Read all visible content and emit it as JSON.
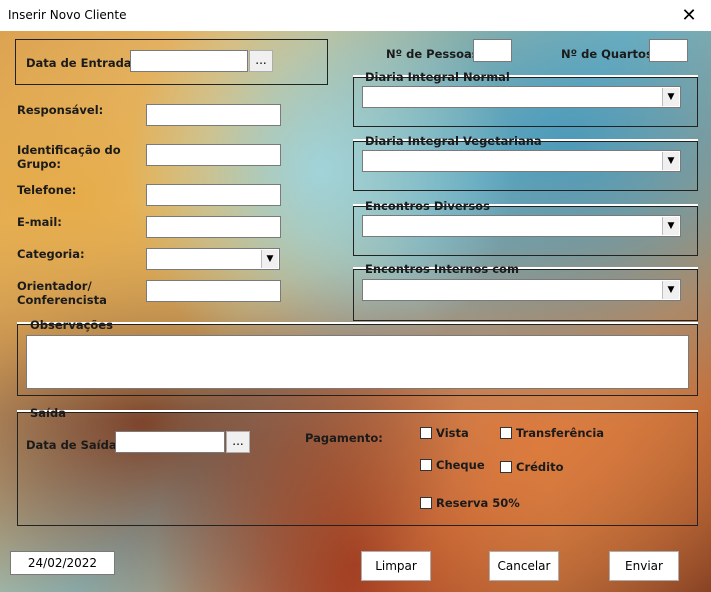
{
  "window": {
    "title": "Inserir Novo Cliente",
    "close": "✕"
  },
  "entrada": {
    "label": "Data de Entrada:",
    "value": "",
    "picker": "..."
  },
  "pessoas": {
    "label": "Nº de Pessoas:",
    "value": ""
  },
  "quartos": {
    "label": "Nº de Quartos:",
    "value": ""
  },
  "fields": {
    "responsavel": {
      "label": "Responsável:",
      "value": ""
    },
    "identificacao": {
      "label": "Identificação do Grupo:",
      "value": ""
    },
    "telefone": {
      "label": "Telefone:",
      "value": ""
    },
    "email": {
      "label": "E-mail:",
      "value": ""
    },
    "categoria": {
      "label": "Categoria:",
      "value": ""
    },
    "orientador": {
      "label": "Orientador/ Conferencista",
      "value": ""
    }
  },
  "combos": {
    "diaria_normal": {
      "label": "Diaria Integral Normal",
      "value": ""
    },
    "diaria_vegetariana": {
      "label": "Diaria Integral Vegetariana",
      "value": ""
    },
    "encontros_diversos": {
      "label": "Encontros Diversos",
      "value": ""
    },
    "encontros_internos": {
      "label": "Encontros Internos com",
      "value": ""
    }
  },
  "observacoes": {
    "label": "Observações",
    "value": ""
  },
  "saida": {
    "label": "Saída",
    "data_label": "Data de Saída:",
    "data_value": "",
    "picker": "...",
    "pagamento_label": "Pagamento:",
    "options": {
      "vista": "Vista",
      "transferencia": "Transferência",
      "cheque": "Cheque",
      "credito": "Crédito",
      "reserva": "Reserva 50%"
    }
  },
  "footer": {
    "date": "24/02/2022",
    "limpar": "Limpar",
    "cancelar": "Cancelar",
    "enviar": "Enviar"
  },
  "icons": {
    "dropdown": "▼"
  }
}
